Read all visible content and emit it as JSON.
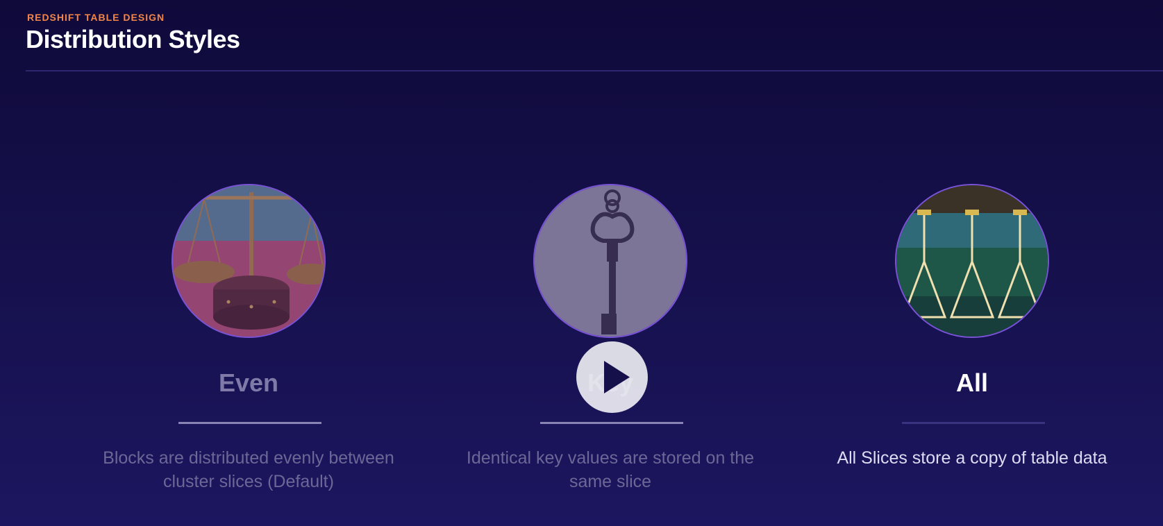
{
  "header": {
    "eyebrow": "REDSHIFT TABLE DESIGN",
    "title": "Distribution Styles"
  },
  "cards": [
    {
      "title": "Even",
      "description": "Blocks are distributed evenly between cluster slices (Default)",
      "image": "balance-scale-photo",
      "state": "dimmed"
    },
    {
      "title": "Key",
      "description": "Identical key values are stored on the same slice",
      "image": "antique-key-photo",
      "state": "dimmed"
    },
    {
      "title": "All",
      "description": "All Slices store a copy of table data",
      "image": "wine-glasses-photo",
      "state": "active"
    }
  ],
  "video": {
    "control": "play-icon"
  },
  "colors": {
    "accent": "#f2854a",
    "background": "#15104a",
    "circle_border": "#7a52d8"
  }
}
